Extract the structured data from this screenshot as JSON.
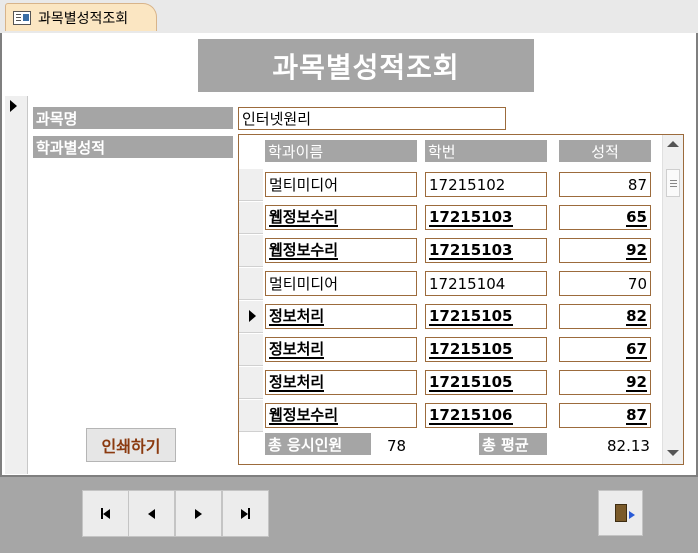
{
  "tab": {
    "icon": "form-icon",
    "label": "과목별성적조회"
  },
  "title": "과목별성적조회",
  "main": {
    "subject_label": "과목명",
    "subject_value": "인터넷원리",
    "dept_grades_label": "학과별성적"
  },
  "subform": {
    "headers": [
      "학과이름",
      "학번",
      "성적"
    ],
    "rows": [
      {
        "dept": "멀티미디어",
        "id": "17215102",
        "score": "87",
        "bold": false
      },
      {
        "dept": "웹정보수리",
        "id": "17215103",
        "score": "65",
        "bold": true
      },
      {
        "dept": "웹정보수리",
        "id": "17215103",
        "score": "92",
        "bold": true
      },
      {
        "dept": "멀티미디어",
        "id": "17215104",
        "score": "70",
        "bold": false
      },
      {
        "dept": "정보처리",
        "id": "17215105",
        "score": "82",
        "bold": true
      },
      {
        "dept": "정보처리",
        "id": "17215105",
        "score": "67",
        "bold": true
      },
      {
        "dept": "정보처리",
        "id": "17215105",
        "score": "92",
        "bold": true
      },
      {
        "dept": "웹정보수리",
        "id": "17215106",
        "score": "87",
        "bold": true
      }
    ],
    "current_row": 4,
    "footer": {
      "count_label": "총 응시인원",
      "count_value": "78",
      "avg_label": "총 평균",
      "avg_value": "82.13"
    }
  },
  "print_button": "인쇄하기",
  "nav": {
    "first": "first-record-icon",
    "prev": "previous-record-icon",
    "next": "next-record-icon",
    "last": "last-record-icon",
    "exit": "exit-door-icon"
  }
}
